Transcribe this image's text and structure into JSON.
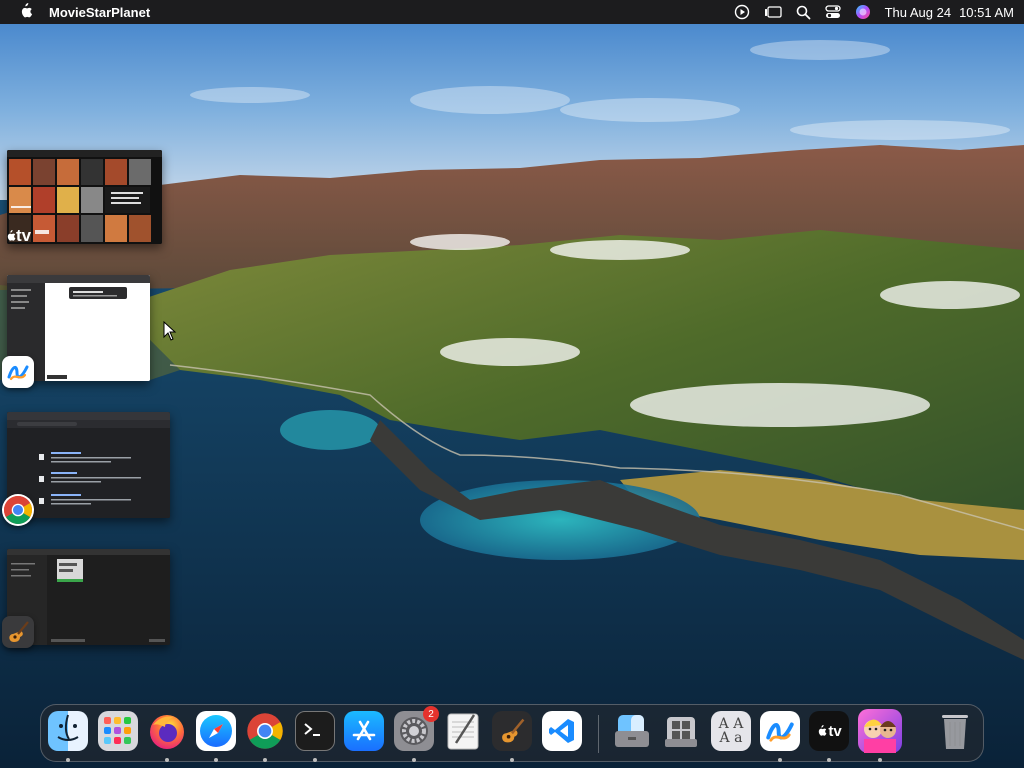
{
  "menubar": {
    "app_name": "MovieStarPlanet",
    "date": "Thu Aug 24",
    "time": "10:51 AM",
    "status_icons": [
      "play-circle-icon",
      "stage-manager-icon",
      "search-icon",
      "control-center-icon",
      "siri-icon"
    ]
  },
  "stage_manager": {
    "groups": [
      {
        "app": "Apple TV",
        "icon": "apple-tv-icon",
        "badge_text": "tv"
      },
      {
        "app": "Freeform",
        "icon": "freeform-icon"
      },
      {
        "app": "Google Chrome",
        "icon": "chrome-icon"
      },
      {
        "app": "GarageBand",
        "icon": "garageband-icon"
      }
    ]
  },
  "dock": {
    "apps": [
      {
        "name": "Finder",
        "icon": "finder-icon"
      },
      {
        "name": "Launchpad",
        "icon": "launchpad-icon"
      },
      {
        "name": "Firefox",
        "icon": "firefox-icon"
      },
      {
        "name": "Safari",
        "icon": "safari-icon"
      },
      {
        "name": "Google Chrome",
        "icon": "chrome-icon"
      },
      {
        "name": "Terminal",
        "icon": "terminal-icon"
      },
      {
        "name": "App Store",
        "icon": "app-store-icon"
      },
      {
        "name": "System Settings",
        "icon": "system-settings-icon",
        "badge": "2"
      },
      {
        "name": "TextEdit",
        "icon": "textedit-icon"
      },
      {
        "name": "GarageBand",
        "icon": "garageband-icon"
      },
      {
        "name": "Visual Studio Code",
        "icon": "vscode-icon"
      },
      {
        "name": "Migration Assistant",
        "icon": "finder-icon"
      },
      {
        "name": "Boot Camp Assistant",
        "icon": "bootcamp-icon"
      },
      {
        "name": "Font Book",
        "icon": "font-book-icon"
      },
      {
        "name": "Freeform",
        "icon": "freeform-icon"
      },
      {
        "name": "Apple TV",
        "icon": "apple-tv-icon",
        "label": "tv"
      },
      {
        "name": "MovieStarPlanet",
        "icon": "moviestarplanet-icon"
      },
      {
        "name": "Trash",
        "icon": "trash-icon"
      }
    ]
  },
  "colors": {
    "menubar_bg": "#1c1c1e",
    "badge_red": "#e5322d",
    "accent_blue": "#1a8cff"
  }
}
